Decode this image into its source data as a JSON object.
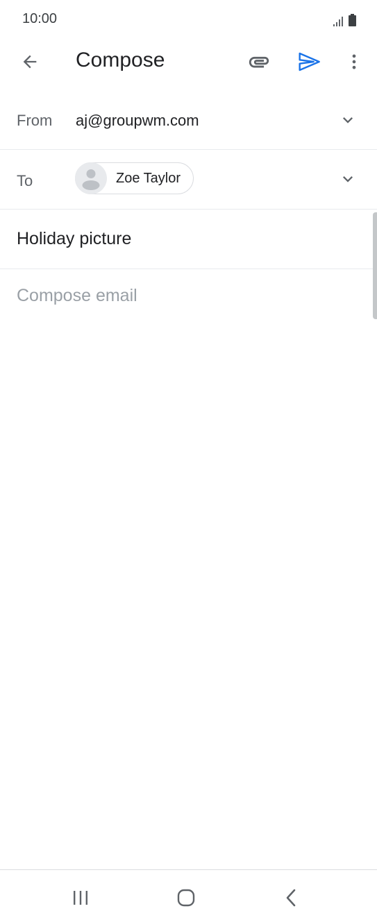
{
  "status_bar": {
    "time": "10:00"
  },
  "toolbar": {
    "title": "Compose",
    "back_icon": "arrow-left-icon",
    "attach_icon": "paperclip-icon",
    "send_icon": "send-icon",
    "more_icon": "more-vertical-icon"
  },
  "from": {
    "label": "From",
    "value": "aj@groupwm.com"
  },
  "to": {
    "label": "To",
    "recipients": [
      {
        "name": "Zoe Taylor"
      }
    ]
  },
  "subject": {
    "value": "Holiday picture"
  },
  "body": {
    "placeholder": "Compose email",
    "value": ""
  },
  "colors": {
    "accent": "#1a73e8",
    "text_primary": "#202124",
    "text_secondary": "#5f6368",
    "placeholder": "#9aa0a6",
    "divider": "#e8eaed"
  }
}
